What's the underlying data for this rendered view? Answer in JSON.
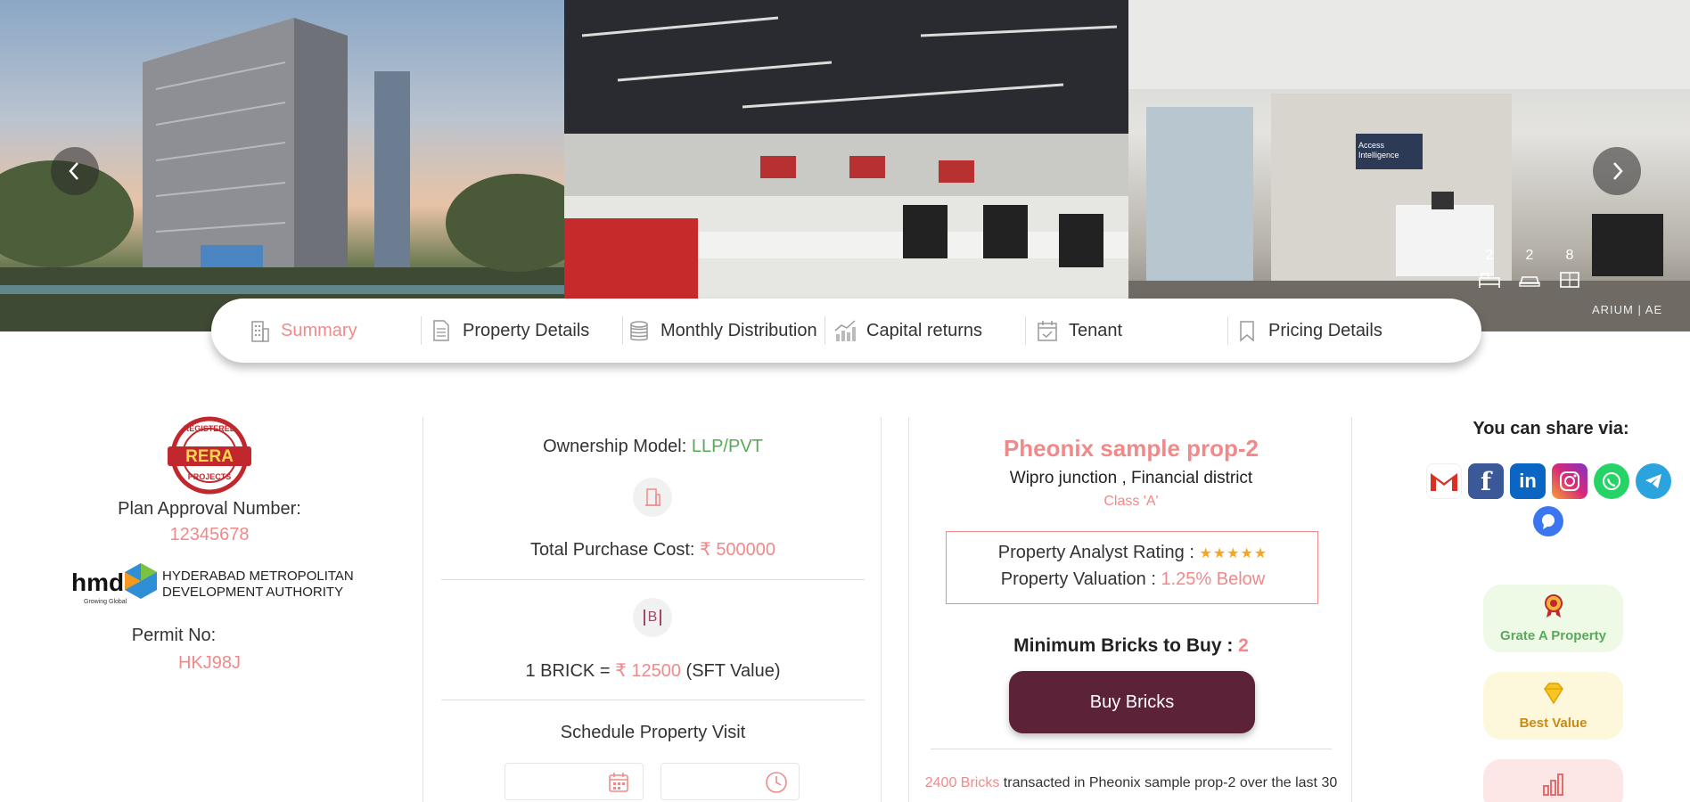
{
  "hero": {
    "features": [
      {
        "count": "2",
        "icon": "bed-icon"
      },
      {
        "count": "2",
        "icon": "car-icon"
      },
      {
        "count": "8",
        "icon": "floorplan-icon"
      }
    ],
    "watermark": "ARIUM | AE",
    "sign_text": "Access Intelligence"
  },
  "tabs": [
    {
      "label": "Summary",
      "icon": "building-icon",
      "active": true
    },
    {
      "label": "Property Details",
      "icon": "document-icon"
    },
    {
      "label": "Monthly Distribution",
      "icon": "coins-icon"
    },
    {
      "label": "Capital returns",
      "icon": "growth-chart-icon"
    },
    {
      "label": "Tenant",
      "icon": "calendar-check-icon"
    },
    {
      "label": "Pricing Details",
      "icon": "bookmark-icon"
    }
  ],
  "approval": {
    "rera_top": "REGISTERED",
    "rera_mid": "RERA",
    "rera_bottom": "PROJECTS",
    "plan_label": "Plan Approval Number:",
    "plan_number": "12345678",
    "hmda_logo": "hmda",
    "hmda_tag": "Growing Global",
    "hmda_line1": "HYDERABAD METROPOLITAN",
    "hmda_line2": "DEVELOPMENT AUTHORITY",
    "permit_label": "Permit No:",
    "permit_number": "HKJ98J"
  },
  "purchase": {
    "ownership_label": "Ownership Model:",
    "ownership_value": "LLP/PVT",
    "total_label": "Total Purchase Cost:",
    "total_value": "₹ 500000",
    "brick_icon_letter": "B",
    "brick_prefix": "1 BRICK =",
    "brick_value": "₹ 12500",
    "brick_suffix": "(SFT Value)",
    "schedule_label": "Schedule Property Visit"
  },
  "property": {
    "name": "Pheonix sample prop-2",
    "location": "Wipro junction , Financial district",
    "class": "Class 'A'",
    "rating_label": "Property Analyst Rating :",
    "rating_stars": 5,
    "valuation_label": "Property Valuation :",
    "valuation_value": "1.25% Below",
    "min_label": "Minimum Bricks to Buy :",
    "min_value": "2",
    "buy_label": "Buy Bricks",
    "transacted_count": "2400 Bricks",
    "transacted_text": "transacted in Pheonix sample prop-2 over the last 30"
  },
  "share": {
    "title": "You can share via:",
    "networks": [
      "gmail-icon",
      "facebook-icon",
      "linkedin-icon",
      "instagram-icon",
      "whatsapp-icon",
      "telegram-icon",
      "signal-icon"
    ],
    "cards": [
      {
        "label": "Grate A Property",
        "icon": "award-icon",
        "color": "#5aa85a",
        "bg": "#eefae6"
      },
      {
        "label": "Best Value",
        "icon": "diamond-icon",
        "color": "#c98a16",
        "bg": "#fdf7dc"
      },
      {
        "label": "",
        "icon": "bar-chart-icon",
        "color": "#e86a6a",
        "bg": "#fde6e6"
      }
    ]
  },
  "colors": {
    "accent": "#f08a8a",
    "primary_button": "#5c2238",
    "green": "#5aa85a"
  }
}
